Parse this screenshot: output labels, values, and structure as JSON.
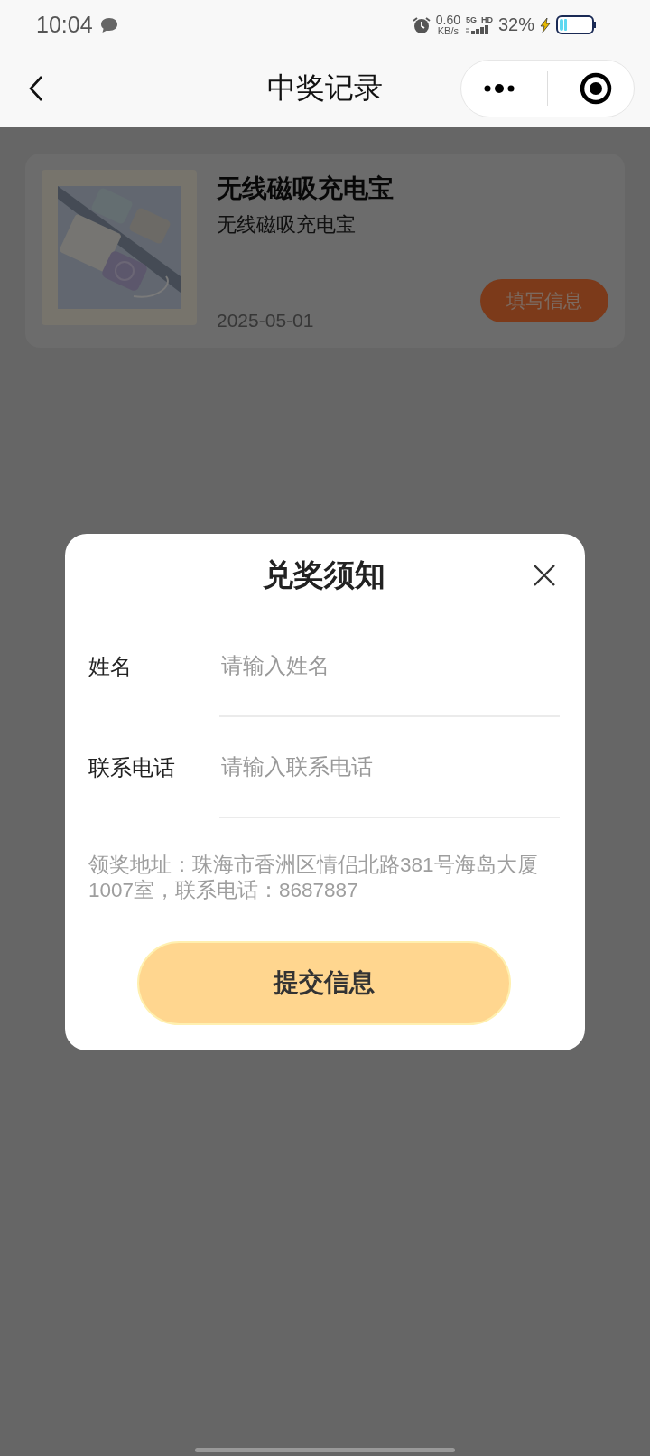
{
  "status_bar": {
    "time": "10:04",
    "net_speed": "0.60",
    "net_unit": "KB/s",
    "network": "5G",
    "hd": "HD",
    "battery": "32%"
  },
  "nav": {
    "title": "中奖记录"
  },
  "records": [
    {
      "title": "无线磁吸充电宝",
      "subtitle": "无线磁吸充电宝",
      "date": "2025-05-01",
      "action": "填写信息"
    }
  ],
  "dialog": {
    "title": "兑奖须知",
    "fields": [
      {
        "label": "姓名",
        "placeholder": "请输入姓名"
      },
      {
        "label": "联系电话",
        "placeholder": "请输入联系电话"
      }
    ],
    "note": "领奖地址：珠海市香洲区情侣北路381号海岛大厦1007室，联系电话：8687887",
    "submit": "提交信息"
  }
}
